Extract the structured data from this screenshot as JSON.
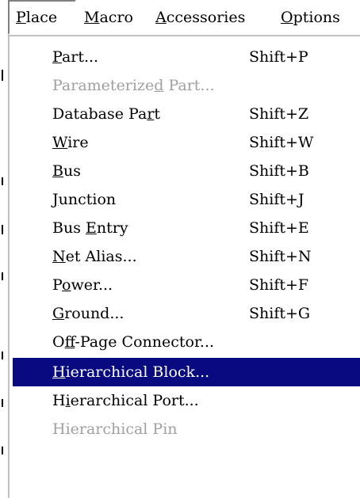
{
  "menubar": {
    "items": [
      {
        "label": "Place",
        "mnemonic": "P",
        "rest": "lace"
      },
      {
        "label": "Macro",
        "mnemonic": "M",
        "rest": "acro"
      },
      {
        "label": "Accessories",
        "mnemonic": "A",
        "rest": "ccessories"
      },
      {
        "label": "Options",
        "mnemonic": "O",
        "rest": "ptions"
      }
    ]
  },
  "place_menu": {
    "items": [
      {
        "label": "Part...",
        "pre": "",
        "mnemonic": "P",
        "post": "art...",
        "shortcut": "Shift+P",
        "enabled": true
      },
      {
        "label": "Parameterized Part...",
        "pre": "Parameterize",
        "mnemonic": "d",
        "post": " Part...",
        "shortcut": "",
        "enabled": false
      },
      {
        "label": "Database Part",
        "pre": "Database Pa",
        "mnemonic": "r",
        "post": "t",
        "shortcut": "Shift+Z",
        "enabled": true
      },
      {
        "label": "Wire",
        "pre": "",
        "mnemonic": "W",
        "post": "ire",
        "shortcut": "Shift+W",
        "enabled": true
      },
      {
        "label": "Bus",
        "pre": "",
        "mnemonic": "B",
        "post": "us",
        "shortcut": "Shift+B",
        "enabled": true
      },
      {
        "label": "Junction",
        "pre": "",
        "mnemonic": "J",
        "post": "unction",
        "shortcut": "Shift+J",
        "enabled": true
      },
      {
        "label": "Bus Entry",
        "pre": "Bus ",
        "mnemonic": "E",
        "post": "ntry",
        "shortcut": "Shift+E",
        "enabled": true
      },
      {
        "label": "Net Alias...",
        "pre": "",
        "mnemonic": "N",
        "post": "et Alias...",
        "shortcut": "Shift+N",
        "enabled": true
      },
      {
        "label": "Power...",
        "pre": "P",
        "mnemonic": "o",
        "post": "wer...",
        "shortcut": "Shift+F",
        "enabled": true
      },
      {
        "label": "Ground...",
        "pre": "",
        "mnemonic": "G",
        "post": "round...",
        "shortcut": "Shift+G",
        "enabled": true
      },
      {
        "label": "Off-Page Connector...",
        "pre": "O",
        "mnemonic": "f",
        "post": "f-Page Connector...",
        "shortcut": "",
        "enabled": true
      },
      {
        "label": "Hierarchical Block...",
        "pre": "",
        "mnemonic": "H",
        "post": "ierarchical Block...",
        "shortcut": "",
        "enabled": true,
        "highlighted": true
      },
      {
        "label": "Hierarchical Port...",
        "pre": "H",
        "mnemonic": "i",
        "post": "erarchical Port...",
        "shortcut": "",
        "enabled": true
      },
      {
        "label": "Hierarchical Pin",
        "pre": "Hierarchical Pin",
        "mnemonic": "",
        "post": "",
        "shortcut": "",
        "enabled": false
      }
    ]
  },
  "colors": {
    "highlight_bg": "#0a0a80",
    "highlight_text": "#ffffff",
    "disabled_text": "#a0a0a0"
  }
}
